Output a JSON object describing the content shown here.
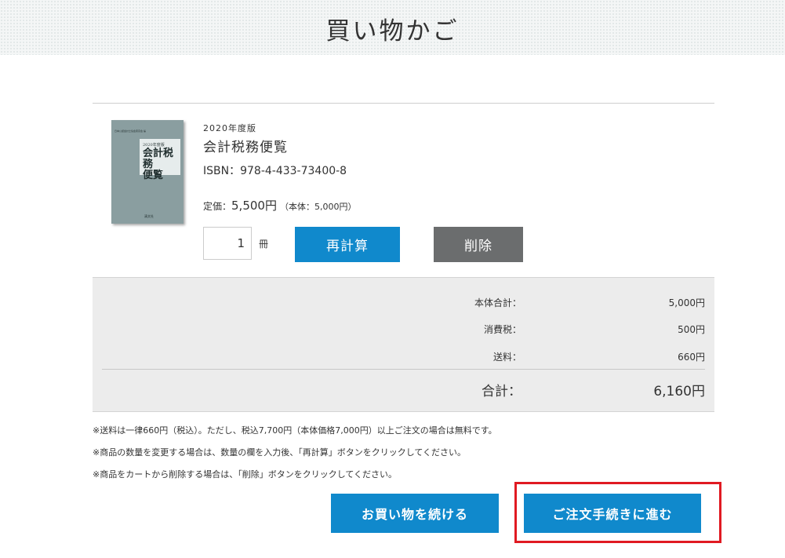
{
  "page": {
    "title": "買い物かご"
  },
  "cart": {
    "item": {
      "edition": "2020年度版",
      "title": "会計税務便覧",
      "isbn": "ISBN：978-4-433-73400-8",
      "price_label": "定価：",
      "price_value": "5,500円",
      "price_note": "（本体：5,000円）",
      "quantity": "1",
      "quantity_unit": "冊",
      "cover": {
        "band_text": "日本公認会計士協会東京会 編",
        "edition": "2020年度版",
        "title_line1": "会計税務",
        "title_line2": "便覧",
        "publisher": "清文社",
        "color": "#8a9ea0"
      }
    },
    "buttons": {
      "recalculate": "再計算",
      "delete": "削除"
    }
  },
  "summary": {
    "rows": [
      {
        "label": "本体合計：",
        "value": "5,000円"
      },
      {
        "label": "消費税：",
        "value": "500円"
      },
      {
        "label": "送料：",
        "value": "660円"
      }
    ],
    "total": {
      "label": "合計：",
      "value": "6,160円"
    }
  },
  "notes": [
    "※送料は一律660円（税込）。ただし、税込7,700円（本体価格7,000円）以上ご注文の場合は無料です。",
    "※商品の数量を変更する場合は、数量の欄を入力後、「再計算」ボタンをクリックしてください。",
    "※商品をカートから削除する場合は、「削除」ボタンをクリックしてください。"
  ],
  "actions": {
    "continue_shopping": "お買い物を続ける",
    "checkout": "ご注文手続きに進む"
  },
  "colors": {
    "primary": "#1089cc",
    "secondary": "#6b6d6e",
    "highlight": "#e01a22",
    "summary_bg": "#ececec"
  }
}
